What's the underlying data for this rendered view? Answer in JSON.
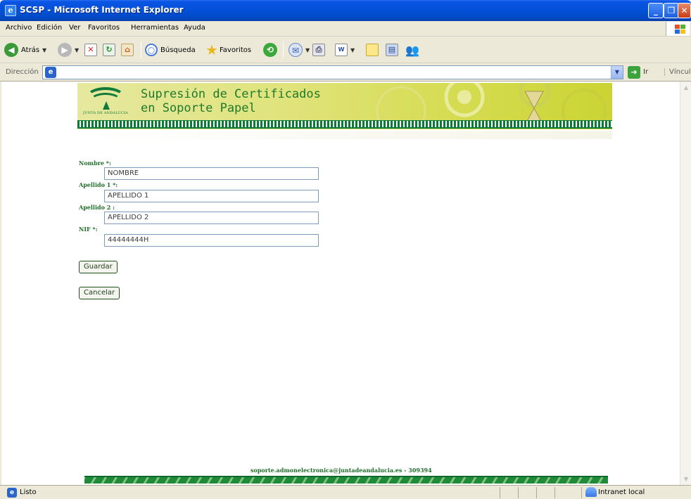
{
  "window": {
    "title": "SCSP - Microsoft Internet Explorer",
    "controls": {
      "minimize": "_",
      "maximize": "❐",
      "close": "✕"
    }
  },
  "menu": {
    "items": [
      "Archivo",
      "Edición",
      "Ver",
      "Favoritos",
      "Herramientas",
      "Ayuda"
    ]
  },
  "toolbar": {
    "back_label": "Atrás",
    "search_label": "Búsqueda",
    "favorites_label": "Favoritos",
    "icons": [
      "back-icon",
      "forward-icon",
      "stop-icon",
      "refresh-icon",
      "home-icon",
      "search-icon",
      "favorites-star-icon",
      "history-icon",
      "mail-icon",
      "print-icon",
      "word-icon",
      "folder-icon",
      "research-icon",
      "messenger-icon"
    ]
  },
  "address": {
    "label": "Dirección",
    "value": "",
    "go_label": "Ir",
    "links_label": "Vínculos"
  },
  "banner": {
    "org_name": "JUNTA DE ANDALUCIA",
    "title_line1": "Supresión de Certificados",
    "title_line2": "en Soporte Papel",
    "brand_color": "#1f7a2c"
  },
  "form": {
    "nombre_label": "Nombre *:",
    "nombre_value": "NOMBRE",
    "apellido1_label": "Apellido 1 *:",
    "apellido1_value": "APELLIDO 1",
    "apellido2_label": "Apellido 2 :",
    "apellido2_value": "APELLIDO 2",
    "nif_label": "NIF *:",
    "nif_value": "44444444H",
    "save_label": "Guardar",
    "cancel_label": "Cancelar"
  },
  "footer": {
    "contact": "soporte.admonelectronica@juntadeandalucia.es - 309394"
  },
  "status": {
    "text": "Listo",
    "zone": "Intranet local"
  }
}
